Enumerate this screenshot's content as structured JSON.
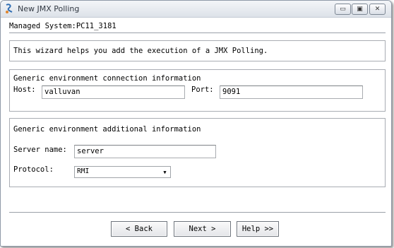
{
  "window": {
    "title": "New JMX Polling",
    "minimize_glyph": "▭",
    "maximize_glyph": "▣",
    "close_glyph": "✕"
  },
  "managed_system": "Managed System:PC11_3181",
  "intro_text": "This wizard helps you add the execution of a JMX Polling.",
  "connection": {
    "heading": "Generic environment connection information",
    "host_label": "Host:",
    "host_value": "valluvan",
    "port_label": "Port:",
    "port_value": "9091"
  },
  "additional": {
    "heading": "Generic environment additional information",
    "server_name_label": "Server name:",
    "server_name_value": "server",
    "protocol_label": "Protocol:",
    "protocol_value": "RMI"
  },
  "buttons": {
    "back": "< Back",
    "next": "Next >",
    "help": "Help >>"
  }
}
